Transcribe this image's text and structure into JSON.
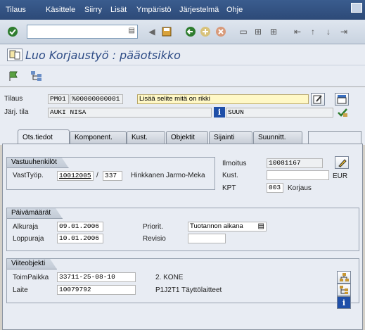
{
  "menu": [
    "Tilaus",
    "Käsittele",
    "Siirry",
    "Lisät",
    "Ympäristö",
    "Järjestelmä",
    "Ohje"
  ],
  "toolbar": {
    "command_value": ""
  },
  "title": "Luo Korjaustyö : pääotsikko",
  "header": {
    "order_label": "Tilaus",
    "order_type": "PM01",
    "order_number": "%00000000001",
    "description": "Lisää selite mitä on rikki",
    "status_label": "Järj. tila",
    "system_status": "AUKI NISA",
    "user_status": "SUUN"
  },
  "tabs": [
    "Ots.tiedot",
    "Komponent.",
    "Kust.",
    "Objektit",
    "Sijainti",
    "Suunnitt."
  ],
  "responsible": {
    "group_title": "Vastuuhenkilöt",
    "person_label": "VastTyöp.",
    "person_number": "10012005",
    "separator": "/",
    "plant": "337",
    "person_name": "Hinkkanen Jarmo-Meka"
  },
  "notification": {
    "label": "Ilmoitus",
    "value": "10081167",
    "cost_label": "Kust.",
    "cost_value": "",
    "currency": "EUR",
    "kpt_label": "KPT",
    "kpt_value": "003",
    "kpt_text": "Korjaus"
  },
  "dates": {
    "group_title": "Päivämäärät",
    "start_label": "Alkuraja",
    "start_value": "09.01.2006",
    "end_label": "Loppuraja",
    "end_value": "10.01.2006",
    "priority_label": "Priorit.",
    "priority_value": "Tuotannon aikana",
    "revision_label": "Revisio",
    "revision_value": ""
  },
  "reference": {
    "group_title": "Viiteobjekti",
    "floc_label": "ToimPaikka",
    "floc_value": "33711-25-08-10",
    "floc_text": "2. KONE",
    "equip_label": "Laite",
    "equip_value": "10079792",
    "equip_text": "P1J2T1 Täyttölaitteet"
  }
}
